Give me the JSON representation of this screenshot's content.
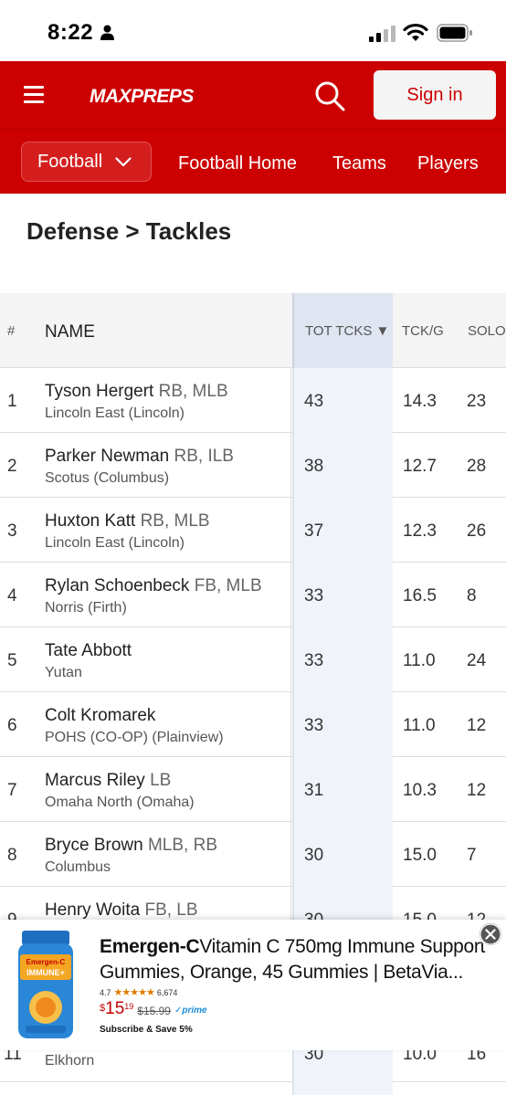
{
  "status_bar": {
    "time": "8:22"
  },
  "header": {
    "logo_text": "MAXPREPS",
    "signin_label": "Sign in"
  },
  "subnav": {
    "sport": "Football",
    "links": [
      "Football Home",
      "Teams",
      "Players"
    ]
  },
  "page_title": "Defense > Tackles",
  "table": {
    "columns": {
      "num": "#",
      "name": "NAME",
      "tot": "TOT TCKS ▼",
      "tckg": "TCK/G",
      "solo": "SOLO"
    },
    "rows": [
      {
        "rank": "1",
        "name": "Tyson Hergert",
        "pos": "RB, MLB",
        "school": "Lincoln East (Lincoln)",
        "tot": "43",
        "tckg": "14.3",
        "solo": "23"
      },
      {
        "rank": "2",
        "name": "Parker Newman",
        "pos": "RB, ILB",
        "school": "Scotus (Columbus)",
        "tot": "38",
        "tckg": "12.7",
        "solo": "28"
      },
      {
        "rank": "3",
        "name": "Huxton Katt",
        "pos": "RB, MLB",
        "school": "Lincoln East (Lincoln)",
        "tot": "37",
        "tckg": "12.3",
        "solo": "26"
      },
      {
        "rank": "4",
        "name": "Rylan Schoenbeck",
        "pos": "FB, MLB",
        "school": "Norris (Firth)",
        "tot": "33",
        "tckg": "16.5",
        "solo": "8"
      },
      {
        "rank": "5",
        "name": "Tate Abbott",
        "pos": "",
        "school": "Yutan",
        "tot": "33",
        "tckg": "11.0",
        "solo": "24"
      },
      {
        "rank": "6",
        "name": "Colt Kromarek",
        "pos": "",
        "school": "POHS (CO-OP) (Plainview)",
        "tot": "33",
        "tckg": "11.0",
        "solo": "12"
      },
      {
        "rank": "7",
        "name": "Marcus Riley",
        "pos": "LB",
        "school": "Omaha North (Omaha)",
        "tot": "31",
        "tckg": "10.3",
        "solo": "12"
      },
      {
        "rank": "8",
        "name": "Bryce Brown",
        "pos": "MLB, RB",
        "school": "Columbus",
        "tot": "30",
        "tckg": "15.0",
        "solo": "7"
      },
      {
        "rank": "9",
        "name": "Henry Woita",
        "pos": "FB, LB",
        "school": "",
        "tot": "30",
        "tckg": "15.0",
        "solo": "12"
      }
    ],
    "partial_row": {
      "rank": "11",
      "school": "Elkhorn",
      "tot": "30",
      "tckg": "10.0",
      "solo": "16"
    }
  },
  "ad": {
    "brand": "Emergen-C",
    "title_line1": "Vitamin C 750mg Immune Support",
    "title_line2": "Gummies, Orange, 45 Gummies | BetaVia...",
    "rating": "4.7",
    "stars": "★★★★★",
    "review_count": "6,674",
    "price_symbol": "$",
    "price_main": "15",
    "price_cents": "19",
    "price_old": "$15.99",
    "prime": "✓prime",
    "subscribe": "Subscribe & Save 5%",
    "product_label": "Emergen-C IMMUNE+"
  },
  "colors": {
    "brand_red": "#cc0000",
    "sorted_col": "#dfe5f1"
  }
}
